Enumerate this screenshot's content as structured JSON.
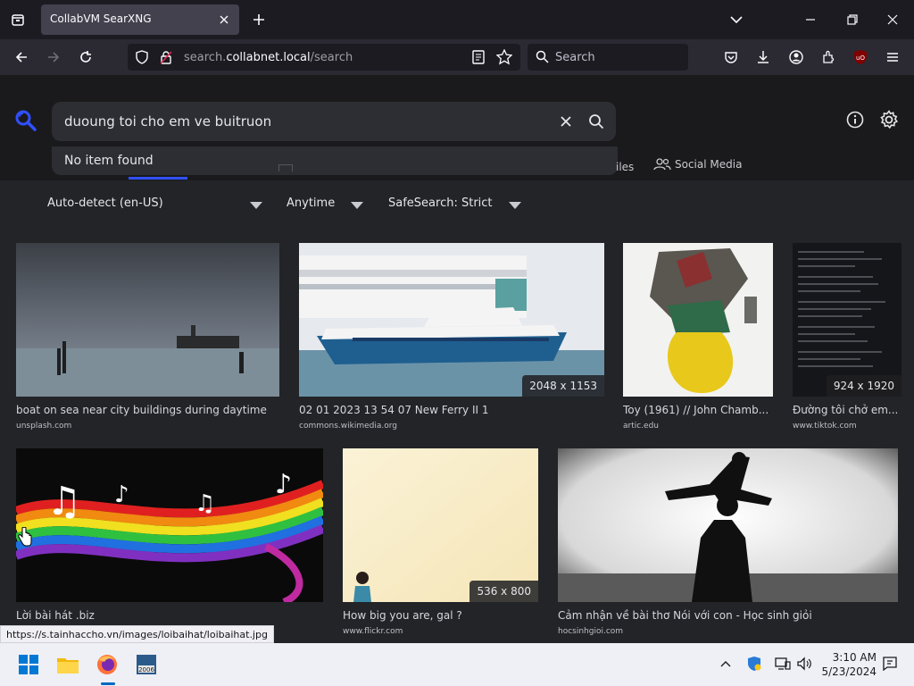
{
  "browser": {
    "tab_title": "CollabVM SearXNG",
    "url_prefix": "search.",
    "url_host": "collabnet.local",
    "url_path": "/search",
    "search_placeholder": "Search",
    "ublock_badge": "uO"
  },
  "search": {
    "query": "duoung toi cho em ve buitruon",
    "autocomplete_text": "No item found"
  },
  "categories": {
    "files_tail": "iles",
    "social_media": "Social Media"
  },
  "filters": {
    "language": "Auto-detect (en-US)",
    "time": "Anytime",
    "safesearch": "SafeSearch: Strict"
  },
  "results": [
    {
      "title": "boat on sea near city buildings during daytime",
      "source": "unsplash.com",
      "dimensions": ""
    },
    {
      "title": "02 01 2023 13 54 07 New Ferry II 1",
      "source": "commons.wikimedia.org",
      "dimensions": "2048 x 1153"
    },
    {
      "title": "Toy (1961) // John Chamb...",
      "source": "artic.edu",
      "dimensions": ""
    },
    {
      "title": "Đường tôi chở em...",
      "source": "www.tiktok.com",
      "dimensions": "924 x 1920"
    },
    {
      "title": "Lời bài hát .biz",
      "source": "",
      "dimensions": ""
    },
    {
      "title": "How big you are, gal ?",
      "source": "www.flickr.com",
      "dimensions": "536 x 800"
    },
    {
      "title": "Cảm nhận về bài thơ Nói với con - Học sinh giỏi",
      "source": "hocsinhgioi.com",
      "dimensions": ""
    }
  ],
  "status_url": "https://s.tainhaccho.vn/images/loibaihat/loibaihat.jpg",
  "taskbar": {
    "time": "3:10 AM",
    "date": "5/23/2024"
  },
  "colors": {
    "accent": "#3050ff",
    "page_bg": "#222428",
    "header_bg": "#1a1a1c"
  }
}
